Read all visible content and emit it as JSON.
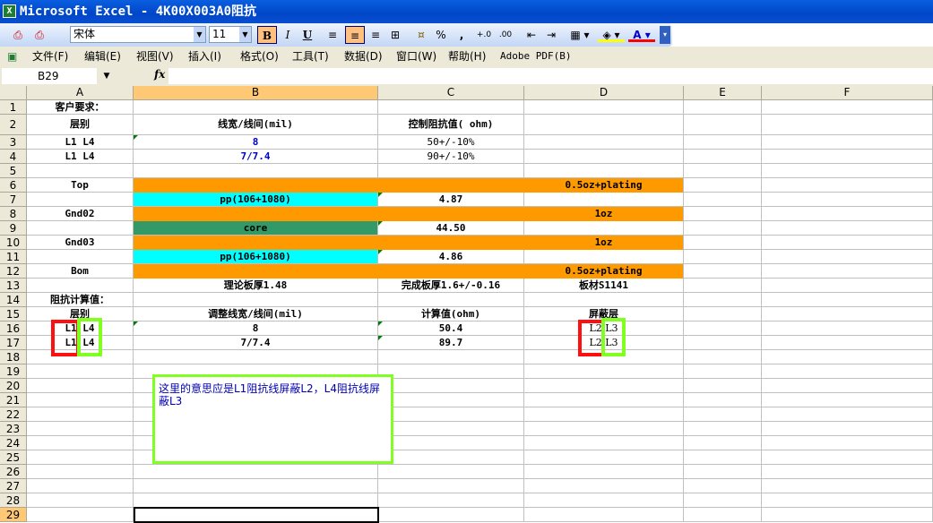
{
  "window": {
    "title": "Microsoft Excel - 4K00X003A0阻抗",
    "app_icon": "excel-icon"
  },
  "toolbar": {
    "font": "宋体",
    "size": "11",
    "bold": "B",
    "italic": "I",
    "underline": "U",
    "percent": "%",
    "comma": ",",
    "inc_decimal": "+.0",
    "dec_decimal": ".00",
    "fill_color": "#ffff00",
    "font_color": "#ff0000"
  },
  "menu": [
    "文件(F)",
    "编辑(E)",
    "视图(V)",
    "插入(I)",
    "格式(O)",
    "工具(T)",
    "数据(D)",
    "窗口(W)",
    "帮助(H)",
    "Adobe PDF(B)"
  ],
  "formula_bar": {
    "name_box": "B29",
    "fx": "fx",
    "value": ""
  },
  "columns": [
    "A",
    "B",
    "C",
    "D",
    "E",
    "F"
  ],
  "selected": {
    "col": "B",
    "row": 29
  },
  "colors": {
    "orange": "#ff9900",
    "cyan": "#00ffff",
    "green": "#339966",
    "blue_text": "#0000cc"
  },
  "rows": [
    [
      "客户要求：",
      "",
      "",
      "",
      "",
      ""
    ],
    [
      "层别",
      "线宽/线间(mil)",
      "控制阻抗值( ohm)",
      "",
      "",
      ""
    ],
    [
      "L1  L4",
      "8",
      "50+/-10%",
      "",
      "",
      ""
    ],
    [
      "L1  L4",
      "7/7.4",
      "90+/-10%",
      "",
      "",
      ""
    ],
    [
      "",
      "",
      "",
      "",
      "",
      ""
    ],
    [
      "Top",
      "",
      "",
      "0.5oz+plating",
      "",
      ""
    ],
    [
      "",
      "pp(106+1080)",
      "4.87",
      "",
      "",
      ""
    ],
    [
      "Gnd02",
      "",
      "",
      "1oz",
      "",
      ""
    ],
    [
      "",
      "core",
      "44.50",
      "",
      "",
      ""
    ],
    [
      "Gnd03",
      "",
      "",
      "1oz",
      "",
      ""
    ],
    [
      "",
      "pp(106+1080)",
      "4.86",
      "",
      "",
      ""
    ],
    [
      "Bom",
      "",
      "",
      "0.5oz+plating",
      "",
      ""
    ],
    [
      "",
      "理论板厚1.48",
      "完成板厚1.6+/-0.16",
      "板材S1141",
      "",
      ""
    ],
    [
      "阻抗计算值：",
      "",
      "",
      "",
      "",
      ""
    ],
    [
      "层别",
      "调整线宽/线间(mil)",
      "计算值(ohm)",
      "屏蔽层",
      "",
      ""
    ],
    [
      "L1 L4",
      "8",
      "50.4",
      "L2 L3",
      "",
      ""
    ],
    [
      "L1 L4",
      "7/7.4",
      "89.7",
      "L2 L3",
      "",
      ""
    ],
    [
      "",
      "",
      "",
      "",
      "",
      ""
    ],
    [
      "",
      "",
      "",
      "",
      "",
      ""
    ],
    [
      "",
      "",
      "",
      "",
      "",
      ""
    ],
    [
      "",
      "",
      "",
      "",
      "",
      ""
    ],
    [
      "",
      "",
      "",
      "",
      "",
      ""
    ],
    [
      "",
      "",
      "",
      "",
      "",
      ""
    ],
    [
      "",
      "",
      "",
      "",
      "",
      ""
    ],
    [
      "",
      "",
      "",
      "",
      "",
      ""
    ],
    [
      "",
      "",
      "",
      "",
      "",
      ""
    ],
    [
      "",
      "",
      "",
      "",
      "",
      ""
    ],
    [
      "",
      "",
      "",
      "",
      "",
      ""
    ],
    [
      "",
      "",
      "",
      "",
      "",
      ""
    ]
  ],
  "note": {
    "text": "这里的意思应是L1阻抗线屏蔽L2，L4阻抗线屏蔽L3"
  }
}
